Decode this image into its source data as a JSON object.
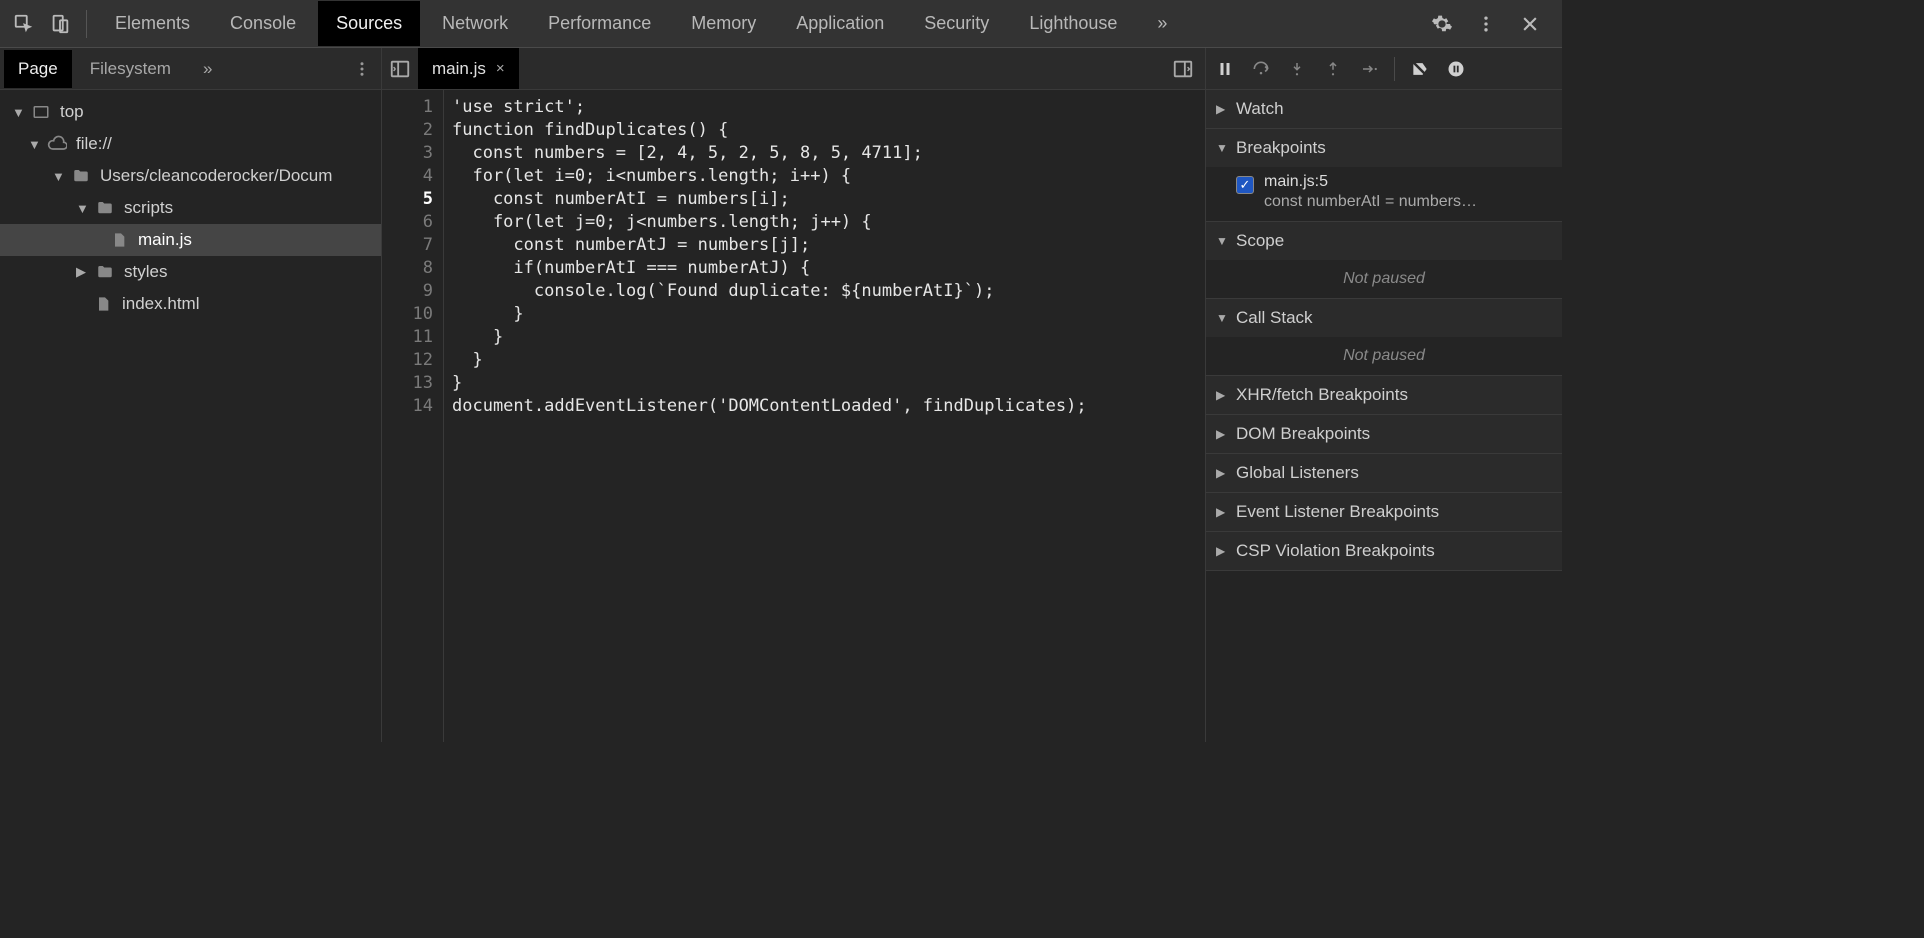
{
  "topTabs": {
    "items": [
      "Elements",
      "Console",
      "Sources",
      "Network",
      "Performance",
      "Memory",
      "Application",
      "Security",
      "Lighthouse"
    ],
    "activeIndex": 2,
    "overflow": "»"
  },
  "navigator": {
    "tabs": {
      "items": [
        "Page",
        "Filesystem"
      ],
      "activeIndex": 0,
      "overflow": "»"
    },
    "tree": {
      "top": "top",
      "origin": "file://",
      "folder": "Users/cleancoderocker/Docum",
      "scripts": "scripts",
      "mainjs": "main.js",
      "styles": "styles",
      "indexhtml": "index.html"
    }
  },
  "editor": {
    "openFile": "main.js",
    "closeSymbol": "×",
    "breakpointLine": 5,
    "lines": [
      "'use strict';",
      "function findDuplicates() {",
      "  const numbers = [2, 4, 5, 2, 5, 8, 5, 4711];",
      "  for(let i=0; i<numbers.length; i++) {",
      "    const numberAtI = numbers[i];",
      "    for(let j=0; j<numbers.length; j++) {",
      "      const numberAtJ = numbers[j];",
      "      if(numberAtI === numberAtJ) {",
      "        console.log(`Found duplicate: ${numberAtI}`);",
      "      }",
      "    }",
      "  }",
      "}",
      "document.addEventListener('DOMContentLoaded', findDuplicates);"
    ]
  },
  "debugger": {
    "sections": {
      "watch": "Watch",
      "breakpoints": "Breakpoints",
      "scope": "Scope",
      "callstack": "Call Stack",
      "xhr": "XHR/fetch Breakpoints",
      "dom": "DOM Breakpoints",
      "global": "Global Listeners",
      "event": "Event Listener Breakpoints",
      "csp": "CSP Violation Breakpoints"
    },
    "breakpoint": {
      "location": "main.js:5",
      "snippet": "const numberAtI = numbers…"
    },
    "notPaused": "Not paused"
  }
}
